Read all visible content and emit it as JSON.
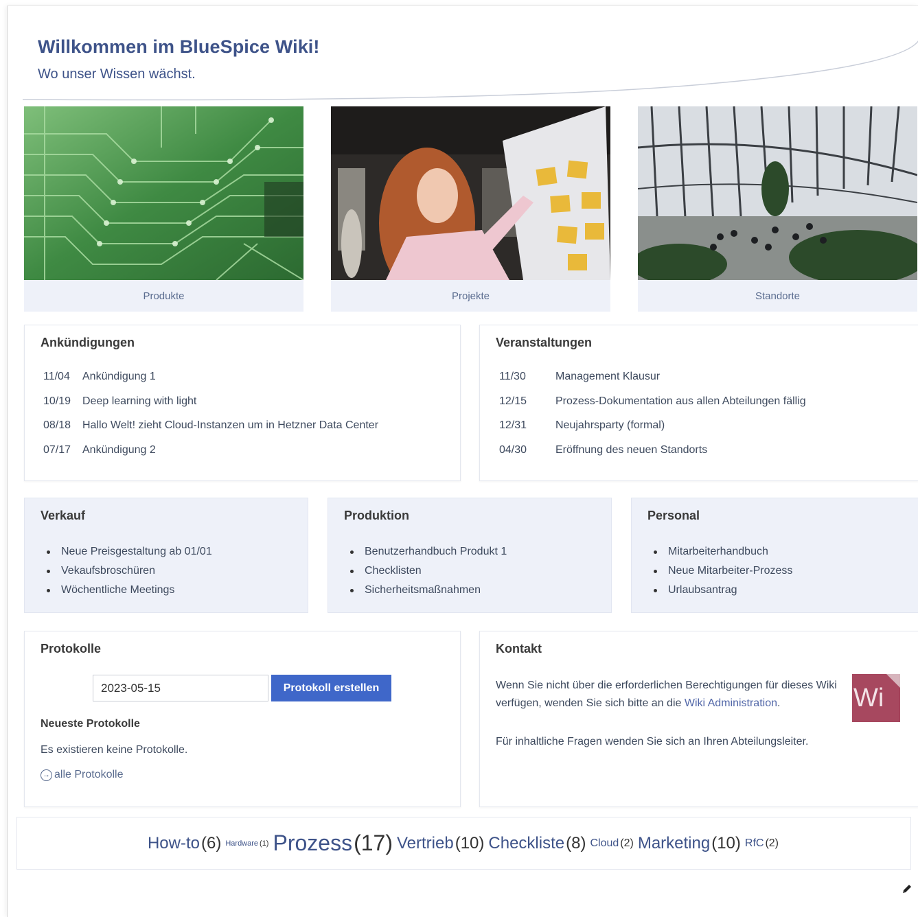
{
  "hero": {
    "title": "Willkommen im BlueSpice Wiki!",
    "subtitle": "Wo unser Wissen wächst."
  },
  "tiles": [
    {
      "caption": "Produkte",
      "image": "circuit-board-photo"
    },
    {
      "caption": "Projekte",
      "image": "meeting-whiteboard-photo"
    },
    {
      "caption": "Standorte",
      "image": "office-atrium-photo"
    }
  ],
  "announcements": {
    "title": "Ankündigungen",
    "items": [
      {
        "date": "11/04",
        "text": "Ankündigung 1"
      },
      {
        "date": "10/19",
        "text": "Deep learning with light"
      },
      {
        "date": "08/18",
        "text": "Hallo Welt! zieht Cloud-Instanzen um in Hetzner Data Center"
      },
      {
        "date": "07/17",
        "text": "Ankündigung 2"
      }
    ]
  },
  "events": {
    "title": "Veranstaltungen",
    "items": [
      {
        "date": "11/30",
        "text": "Management Klausur"
      },
      {
        "date": "12/15",
        "text": "Prozess-Dokumentation aus allen Abteilungen fällig"
      },
      {
        "date": "12/31",
        "text": "Neujahrsparty (formal)"
      },
      {
        "date": "04/30",
        "text": "Eröffnung des neuen Standorts"
      }
    ]
  },
  "departments": [
    {
      "title": "Verkauf",
      "items": [
        "Neue Preisgestaltung ab 01/01",
        "Vekaufsbroschüren",
        "Wöchentliche Meetings"
      ]
    },
    {
      "title": "Produktion",
      "items": [
        "Benutzerhandbuch Produkt 1",
        "Checklisten",
        "Sicherheitsmaßnahmen"
      ]
    },
    {
      "title": "Personal",
      "items": [
        "Mitarbeiterhandbuch",
        "Neue Mitarbeiter-Prozess",
        "Urlaubsantrag"
      ]
    }
  ],
  "protocols": {
    "title": "Protokolle",
    "date_value": "2023-05-15",
    "button_label": "Protokoll erstellen",
    "latest_heading": "Neueste Protokolle",
    "none_text": "Es existieren keine Protokolle.",
    "all_link": "alle Protokolle"
  },
  "contact": {
    "title": "Kontakt",
    "text_before_link": "Wenn Sie nicht über die erforderlichen Berechtigungen für dieses Wiki verfügen, wenden Sie sich bitte an die ",
    "link_text": "Wiki Administration",
    "text_after_link": ".",
    "text2": "Für inhaltliche Fragen wenden Sie sich an Ihren Abteilungsleiter.",
    "logo_text": "Wi"
  },
  "tag_cloud": [
    {
      "label": "How-to",
      "count": "(6)",
      "size": "l"
    },
    {
      "label": "Hardware",
      "count": "(1)",
      "size": "s"
    },
    {
      "label": "Prozess",
      "count": "(17)",
      "size": "xl"
    },
    {
      "label": "Vertrieb",
      "count": "(10)",
      "size": "l"
    },
    {
      "label": "Checkliste",
      "count": "(8)",
      "size": "l"
    },
    {
      "label": "Cloud",
      "count": "(2)",
      "size": "m"
    },
    {
      "label": "Marketing",
      "count": "(10)",
      "size": "l"
    },
    {
      "label": "RfC",
      "count": "(2)",
      "size": "m"
    }
  ],
  "colors": {
    "brand_blue": "#3e5389",
    "button_blue": "#3f67c9",
    "panel_bg": "#eef1f9",
    "logo_bg": "#a7485f"
  },
  "icons": {
    "edit": "pencil-icon",
    "all_protocols": "arrow-circle-icon"
  }
}
